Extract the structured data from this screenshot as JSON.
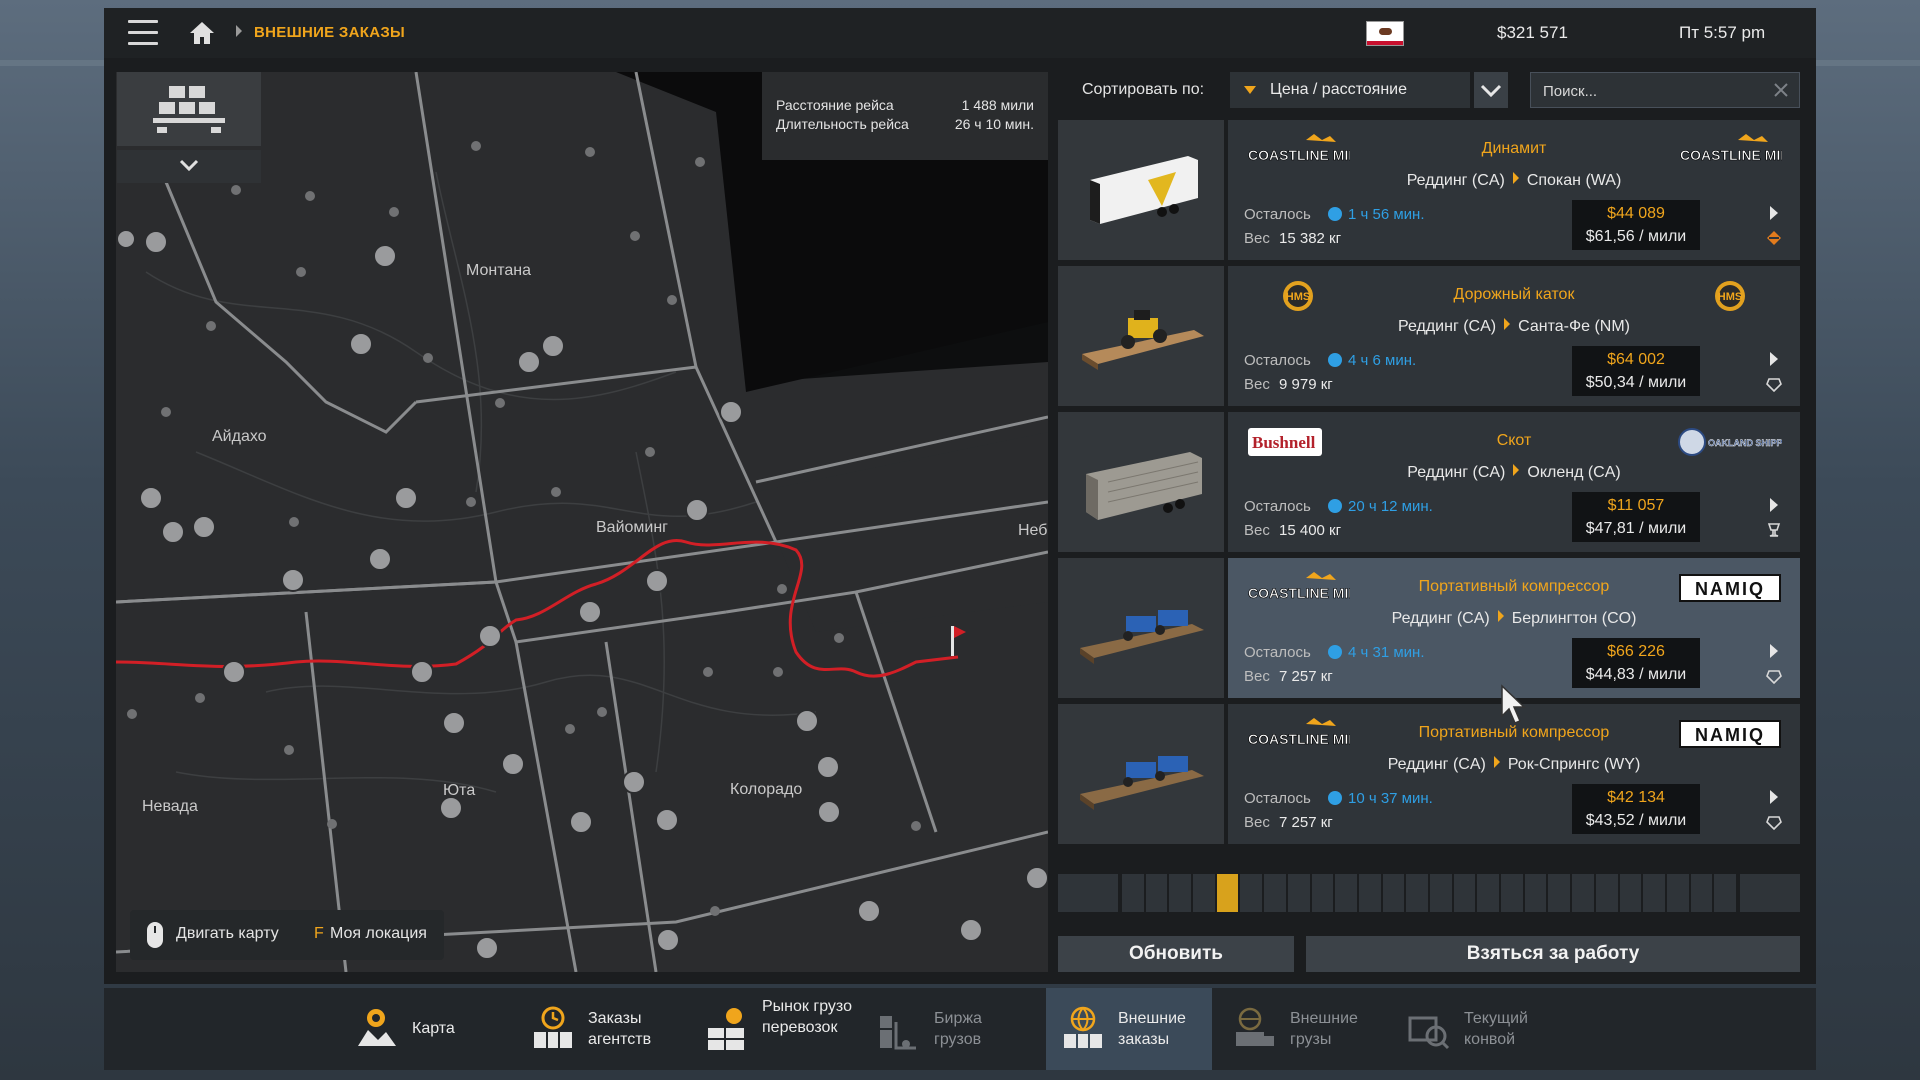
{
  "topbar": {
    "breadcrumb": "ВНЕШНИЕ ЗАКАЗЫ",
    "money": "$321 571",
    "clock": "Пт 5:57 pm",
    "icons": [
      "menu-icon",
      "home-icon",
      "california-flag-icon"
    ]
  },
  "map": {
    "states": [
      "Монтана",
      "Айдахо",
      "Вайоминг",
      "Неб",
      "Юта",
      "Колорадо",
      "Невада"
    ],
    "trip": {
      "distance_label": "Расстояние рейса",
      "distance_value": "1 488 мили",
      "duration_label": "Длительность рейса",
      "duration_value": "26 ч 10 мин."
    },
    "hints": {
      "move_label": "Двигать карту",
      "locate_key": "F",
      "locate_label": "Моя локация"
    },
    "route_color": "#d21f26"
  },
  "sort": {
    "label": "Сортировать по:",
    "value": "Цена / расстояние"
  },
  "search": {
    "placeholder": "Поиск..."
  },
  "jobs": [
    {
      "cargo": "Динамит",
      "from": "Реддинг (CA)",
      "to": "Спокан (WA)",
      "remaining_label": "Осталось",
      "remaining": "1 ч 56 мин.",
      "weight_label": "Вес",
      "weight": "15 382 кг",
      "price": "$44 089",
      "per_mile": "$61,56 / мили",
      "logo_left": "COASTLINE MINING",
      "logo_right": "COASTLINE MINING",
      "trailer": "curtain",
      "cargo_icon": "hazard-explosive-icon"
    },
    {
      "cargo": "Дорожный каток",
      "from": "Реддинг (CA)",
      "to": "Санта-Фе (NM)",
      "remaining_label": "Осталось",
      "remaining": "4 ч 6 мин.",
      "weight_label": "Вес",
      "weight": "9 979 кг",
      "price": "$64 002",
      "per_mile": "$50,34 / мили",
      "logo_left": "HMS",
      "logo_right": "HMS",
      "trailer": "flatbed-roller",
      "cargo_icon": "heavy-cargo-icon"
    },
    {
      "cargo": "Скот",
      "from": "Реддинг (CA)",
      "to": "Окленд (CA)",
      "remaining_label": "Осталось",
      "remaining": "20 ч 12 мин.",
      "weight_label": "Вес",
      "weight": "15 400 кг",
      "price": "$11 057",
      "per_mile": "$47,81 / мили",
      "logo_left": "Bushnell",
      "logo_right": "OAKLAND SHIPPERS",
      "trailer": "livestock",
      "cargo_icon": "fragile-cargo-icon"
    },
    {
      "cargo": "Портативный компрессор",
      "from": "Реддинг (CA)",
      "to": "Берлингтон (CO)",
      "remaining_label": "Осталось",
      "remaining": "4 ч 31 мин.",
      "weight_label": "Вес",
      "weight": "7 257 кг",
      "price": "$66 226",
      "per_mile": "$44,83 / мили",
      "logo_left": "COASTLINE MINING",
      "logo_right": "NAMIQ",
      "trailer": "flatbed-compressor",
      "cargo_icon": "heavy-cargo-icon",
      "selected": true
    },
    {
      "cargo": "Портативный компрессор",
      "from": "Реддинг (CA)",
      "to": "Рок-Спрингс (WY)",
      "remaining_label": "Осталось",
      "remaining": "10 ч 37 мин.",
      "weight_label": "Вес",
      "weight": "7 257 кг",
      "price": "$42 134",
      "per_mile": "$43,52 / мили",
      "logo_left": "COASTLINE MINING",
      "logo_right": "NAMIQ",
      "trailer": "flatbed-compressor",
      "cargo_icon": "heavy-cargo-icon"
    }
  ],
  "pager": {
    "total": 26,
    "current": 5,
    "accent": "#d8a21c"
  },
  "actions": {
    "refresh": "Обновить",
    "accept": "Взяться за работу"
  },
  "tabs": [
    {
      "label": "Карта",
      "icon": "map-pin-icon",
      "active": false,
      "dim": false
    },
    {
      "label": "Заказы агентств",
      "icon": "clock-cargo-icon",
      "active": false,
      "dim": false
    },
    {
      "label": "Рынок грузоперевозок",
      "icon": "cargo-market-icon",
      "active": false,
      "dim": false
    },
    {
      "label": "Биржа грузов",
      "icon": "freight-exchange-icon",
      "active": false,
      "dim": true
    },
    {
      "label": "Внешние заказы",
      "icon": "globe-cargo-icon",
      "active": true,
      "dim": false
    },
    {
      "label": "Внешние грузы",
      "icon": "globe-truck-icon",
      "active": false,
      "dim": true
    },
    {
      "label": "Текущий конвой",
      "icon": "convoy-icon",
      "active": false,
      "dim": true
    }
  ]
}
